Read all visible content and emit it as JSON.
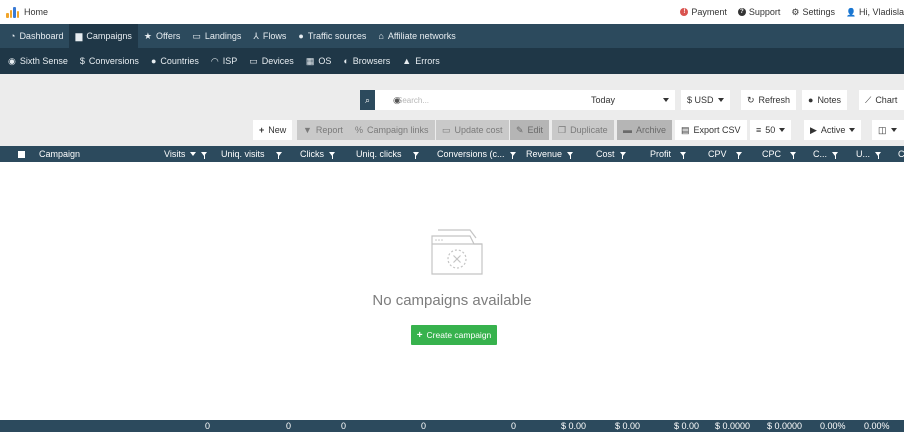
{
  "topbar": {
    "home_label": "Home",
    "payment_label": "Payment",
    "support_label": "Support",
    "settings_label": "Settings",
    "user_label": "Hi, Vladisla"
  },
  "nav_primary": [
    {
      "label": "Dashboard",
      "icon": "dashboard-icon",
      "active": false
    },
    {
      "label": "Campaigns",
      "icon": "briefcase-icon",
      "active": true
    },
    {
      "label": "Offers",
      "icon": "star-icon",
      "active": false
    },
    {
      "label": "Landings",
      "icon": "window-icon",
      "active": false
    },
    {
      "label": "Flows",
      "icon": "sitemap-icon",
      "active": false
    },
    {
      "label": "Traffic sources",
      "icon": "globe-icon",
      "active": false
    },
    {
      "label": "Affiliate networks",
      "icon": "bank-icon",
      "active": false
    }
  ],
  "nav_secondary": [
    {
      "label": "Sixth Sense",
      "icon": "eye-icon"
    },
    {
      "label": "Conversions",
      "icon": "dollar-icon"
    },
    {
      "label": "Countries",
      "icon": "globe-icon"
    },
    {
      "label": "ISP",
      "icon": "wifi-icon"
    },
    {
      "label": "Devices",
      "icon": "laptop-icon"
    },
    {
      "label": "OS",
      "icon": "windows-icon"
    },
    {
      "label": "Browsers",
      "icon": "browser-icon"
    },
    {
      "label": "Errors",
      "icon": "warning-icon"
    }
  ],
  "filters": {
    "search_placeholder": "Search...",
    "date_range": "Today",
    "currency": "$ USD",
    "refresh_label": "Refresh",
    "notes_label": "Notes",
    "chart_label": "Chart"
  },
  "toolbar": {
    "new_label": "New",
    "report_label": "Report",
    "campaign_links_label": "Campaign links",
    "update_cost_label": "Update cost",
    "edit_label": "Edit",
    "duplicate_label": "Duplicate",
    "archive_label": "Archive",
    "export_csv_label": "Export CSV",
    "page_size": "50",
    "status_filter": "Active"
  },
  "table": {
    "columns": [
      "Campaign",
      "Visits",
      "Uniq. visits",
      "Clicks",
      "Uniq. clicks",
      "Conversions (c...",
      "Revenue",
      "Cost",
      "Profit",
      "CPV",
      "CPC",
      "C...",
      "U...",
      "C"
    ],
    "empty_message": "No campaigns available",
    "create_label": "Create campaign",
    "totals": [
      "0",
      "0",
      "0",
      "0",
      "0",
      "$ 0.00",
      "$ 0.00",
      "$ 0.00",
      "$ 0.0000",
      "$ 0.0000",
      "0.00%",
      "0.00%"
    ]
  },
  "colors": {
    "nav_primary_bg": "#2c4a5d",
    "nav_secondary_bg": "#1f3747",
    "toolbar_bg": "#ececec",
    "create_button": "#37b24d",
    "logo": "#f1a52b"
  }
}
